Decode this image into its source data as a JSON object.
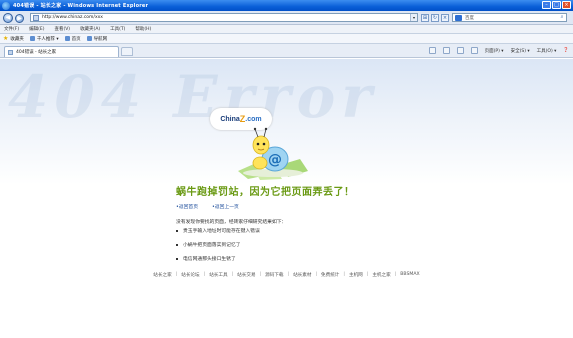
{
  "window": {
    "title": "404错误 - 站长之家 - Windows Internet Explorer"
  },
  "address": {
    "url": "http://www.chinaz.com/xxx"
  },
  "search": {
    "placeholder": "百度"
  },
  "menu": [
    "文件(F)",
    "编辑(E)",
    "查看(V)",
    "收藏夹(A)",
    "工具(T)",
    "帮助(H)"
  ],
  "favorites": {
    "label": "收藏夹",
    "items": [
      "千人推荐 ▾",
      "首页",
      "导航网"
    ]
  },
  "tab": {
    "label": "404错误 - 站长之家"
  },
  "commandbar": {
    "page": "页面(P) ▾",
    "safety": "安全(S) ▾",
    "tools": "工具(O) ▾",
    "help": "❓"
  },
  "content": {
    "watermark": "404 Error",
    "logo": {
      "china": "China",
      "z": "Z",
      "com": ".com"
    },
    "headline": "蜗牛跑掉罚站，因为它把页面弄丢了！",
    "links": {
      "home": "•返回首页",
      "back": "•返回上一页"
    },
    "explanation": "没有发现你要找的页面，经砖家仔细研究结果如下：",
    "reasons": [
      "贵玉手输入地址时可能存在键入错误",
      "小蜗牛把页面落实到记忆了",
      "电信网通那头接口生锈了"
    ]
  },
  "footer": [
    "站长之家",
    "站长论坛",
    "站长工具",
    "站长交易",
    "源码下载",
    "站长素材",
    "免费统计",
    "主机网",
    "主机之家",
    "BBSMAX"
  ],
  "colors": {
    "headline": "#6a9a14",
    "link": "#1f4f9c",
    "titlebar": "#0a5fd8"
  }
}
